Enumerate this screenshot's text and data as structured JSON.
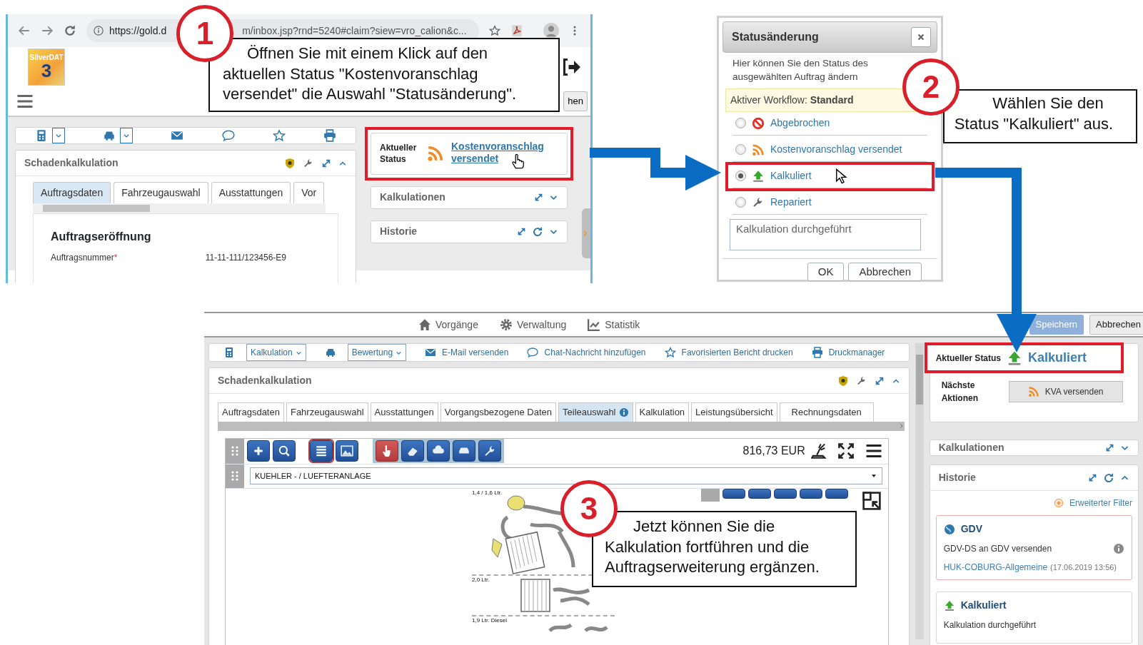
{
  "step1": {
    "callout": {
      "number": "1",
      "text": "Öffnen Sie mit einem Klick auf den aktuellen Status \"Kostenvoranschlag versendet\" die Auswahl \"Statusänderung\"."
    },
    "browser": {
      "url_start": "https://gold.d",
      "url_end": "m/inbox.jsp?rnd=5240#claim?siew=vro_calion&c..."
    },
    "logo": {
      "brand": "SilverDAT",
      "version": "3"
    },
    "header_button": "hen",
    "module": {
      "title": "Schadenkalkulation",
      "tabs": [
        {
          "label": "Auftragsdaten",
          "selected": true
        },
        {
          "label": "Fahrzeugauswahl",
          "selected": false
        },
        {
          "label": "Ausstattungen",
          "selected": false
        },
        {
          "label": "Vor",
          "selected": false
        }
      ],
      "section_title": "Auftragseröffnung",
      "field": {
        "label": "Auftragsnummer",
        "required_mark": "*",
        "value": "11-11-111/123456-E9"
      }
    },
    "status": {
      "label": "Aktueller Status",
      "value": "Kostenvoranschlag versendet",
      "highlighted": true
    },
    "panels": [
      "Kalkulationen",
      "Historie"
    ]
  },
  "step2": {
    "callout": {
      "number": "2",
      "text": "Wählen Sie den Status \"Kalkuliert\" aus."
    },
    "dialog": {
      "title": "Statusänderung",
      "description": "Hier können Sie den Status des ausgewählten Auftrag ändern",
      "workflow": "Aktiver Workflow: **Standard**",
      "options": [
        {
          "kind": "cancelled",
          "label": "Abgebrochen",
          "selected": false,
          "highlighted": false
        },
        {
          "kind": "quote",
          "label": "Kostenvoranschlag versendet",
          "selected": false,
          "highlighted": false
        },
        {
          "kind": "calculated",
          "label": "Kalkuliert",
          "selected": true,
          "highlighted": true
        },
        {
          "kind": "repaired",
          "label": "Repariert",
          "selected": false,
          "highlighted": false
        }
      ],
      "note": "Kalkulation durchgeführt",
      "buttons": [
        "OK",
        "Abbrechen"
      ]
    }
  },
  "step3": {
    "callout": {
      "number": "3",
      "text": "Jetzt können Sie die Kalkulation fortführen und die Auftragserweiterung ergänzen."
    },
    "nav": [
      {
        "kind": "home",
        "label": "Vorgänge"
      },
      {
        "kind": "gear",
        "label": "Verwaltung"
      },
      {
        "kind": "chart",
        "label": "Statistik"
      }
    ],
    "buttons": [
      {
        "kind": "primary",
        "label": "Speichern"
      },
      {
        "kind": "secondary",
        "label": "Abbrechen"
      }
    ],
    "toolbar": [
      {
        "kind": "calc",
        "select": "Kalkulation"
      },
      {
        "kind": "car",
        "select": "Bewertung"
      },
      {
        "kind": "mail",
        "label": "E-Mail versenden"
      },
      {
        "kind": "chat",
        "label": "Chat-Nachricht hinzufügen"
      },
      {
        "kind": "star",
        "label": "Favorisierten Bericht drucken"
      },
      {
        "kind": "print",
        "label": "Druckmanager"
      }
    ],
    "module": {
      "title": "Schadenkalkulation",
      "tabs": [
        {
          "label": "Auftragsdaten",
          "selected": false,
          "info": false
        },
        {
          "label": "Fahrzeugauswahl",
          "selected": false,
          "info": false
        },
        {
          "label": "Ausstattungen",
          "selected": false,
          "info": false
        },
        {
          "label": "Vorgangsbezogene Daten",
          "selected": false,
          "info": false
        },
        {
          "label": "Teileauswahl",
          "selected": true,
          "info": true
        },
        {
          "label": "Kalkulation",
          "selected": false,
          "info": false
        },
        {
          "label": "Leistungsübersicht",
          "selected": false,
          "info": false
        },
        {
          "label": "Rechnungsdaten",
          "selected": false,
          "info": false
        }
      ],
      "total": "816,73 EUR",
      "group": "KUEHLER - / LUEFTERANLAGE",
      "drawing_labels": [
        "1,4 / 1,6 Ltr.",
        "2,0 Ltr.",
        "1,9 Ltr. Diesel"
      ]
    },
    "status": {
      "label": "Aktueller Status",
      "value": "Kalkuliert",
      "highlighted": true
    },
    "next": {
      "label": "Nächste Aktionen",
      "button": "KVA versenden"
    },
    "panels": [
      "Kalkulationen",
      "Historie"
    ],
    "filter": "Erweiterter Filter",
    "history": [
      {
        "kind": "gdv",
        "title": "GDV",
        "text": "GDV-DS an GDV versenden",
        "source": "HUK-COBURG-Allgemeine",
        "date": "(17.06.2019 13:56)",
        "info": true
      },
      {
        "kind": "calculated",
        "title": "Kalkuliert",
        "text": "Kalkulation durchgeführt",
        "info": false
      }
    ]
  }
}
